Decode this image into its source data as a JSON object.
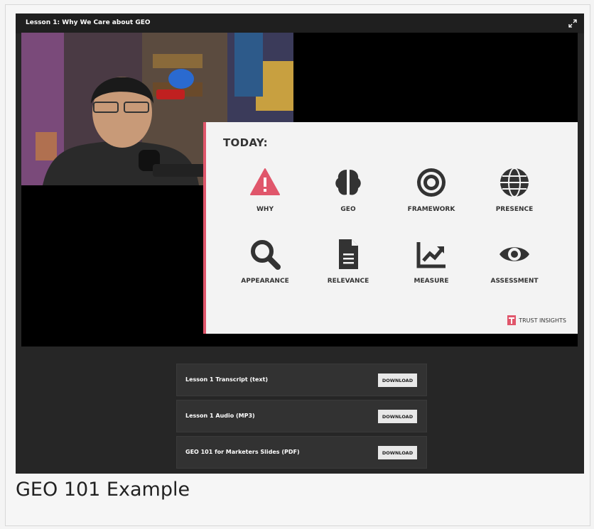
{
  "player": {
    "title": "Lesson 1: Why We Care about GEO"
  },
  "slide": {
    "heading": "TODAY:",
    "items": [
      {
        "label": "WHY",
        "icon": "warning-icon"
      },
      {
        "label": "GEO",
        "icon": "brain-icon"
      },
      {
        "label": "FRAMEWORK",
        "icon": "target-icon"
      },
      {
        "label": "PRESENCE",
        "icon": "globe-icon"
      },
      {
        "label": "APPEARANCE",
        "icon": "search-icon"
      },
      {
        "label": "RELEVANCE",
        "icon": "document-icon"
      },
      {
        "label": "MEASURE",
        "icon": "chart-icon"
      },
      {
        "label": "ASSESSMENT",
        "icon": "eye-icon"
      }
    ],
    "brand": "TRUST INSIGHTS",
    "accent": "#e0566b"
  },
  "downloads": [
    {
      "label": "Lesson 1 Transcript (text)",
      "button": "DOWNLOAD"
    },
    {
      "label": "Lesson 1 Audio (MP3)",
      "button": "DOWNLOAD"
    },
    {
      "label": "GEO 101 for Marketers Slides (PDF)",
      "button": "DOWNLOAD"
    }
  ],
  "caption": "GEO 101 Example"
}
